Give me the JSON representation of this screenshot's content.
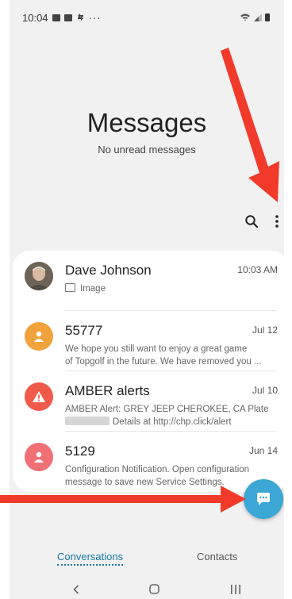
{
  "status_bar": {
    "time": "10:04",
    "dots": "···"
  },
  "header": {
    "title": "Messages",
    "subtitle": "No unread messages"
  },
  "toolbar": {
    "search_icon": "search-icon",
    "more_icon": "more-vertical-icon"
  },
  "conversations": [
    {
      "name": "Dave Johnson",
      "time": "10:03 AM",
      "preview": [
        "Image"
      ],
      "avatar": "photo",
      "preview_icon": "image-icon"
    },
    {
      "name": "55777",
      "time": "Jul 12",
      "preview": [
        "We hope you still want to enjoy a great game",
        "of Topgolf in the future. We have removed you ..."
      ],
      "avatar": "person-icon",
      "avatar_color": "#f2a23a"
    },
    {
      "name": "AMBER alerts",
      "time": "Jul 10",
      "preview": [
        "AMBER Alert: GREY JEEP CHEROKEE, CA Plate",
        "Details at http://chp.click/alert"
      ],
      "avatar": "warning-icon",
      "avatar_color": "#f05a4b"
    },
    {
      "name": "5129",
      "time": "Jun 14",
      "preview": [
        "Configuration Notification. Open configuration",
        "message to save new Service Settings."
      ],
      "avatar": "person-icon",
      "avatar_color": "#f07076"
    }
  ],
  "fab": {
    "icon": "chat-bubble-icon",
    "color": "#3aa7d4"
  },
  "tabs": [
    {
      "label": "Conversations",
      "active": true
    },
    {
      "label": "Contacts",
      "active": false
    }
  ],
  "colors": {
    "accent": "#1a77a8",
    "annotation_red": "#f23a2a"
  }
}
